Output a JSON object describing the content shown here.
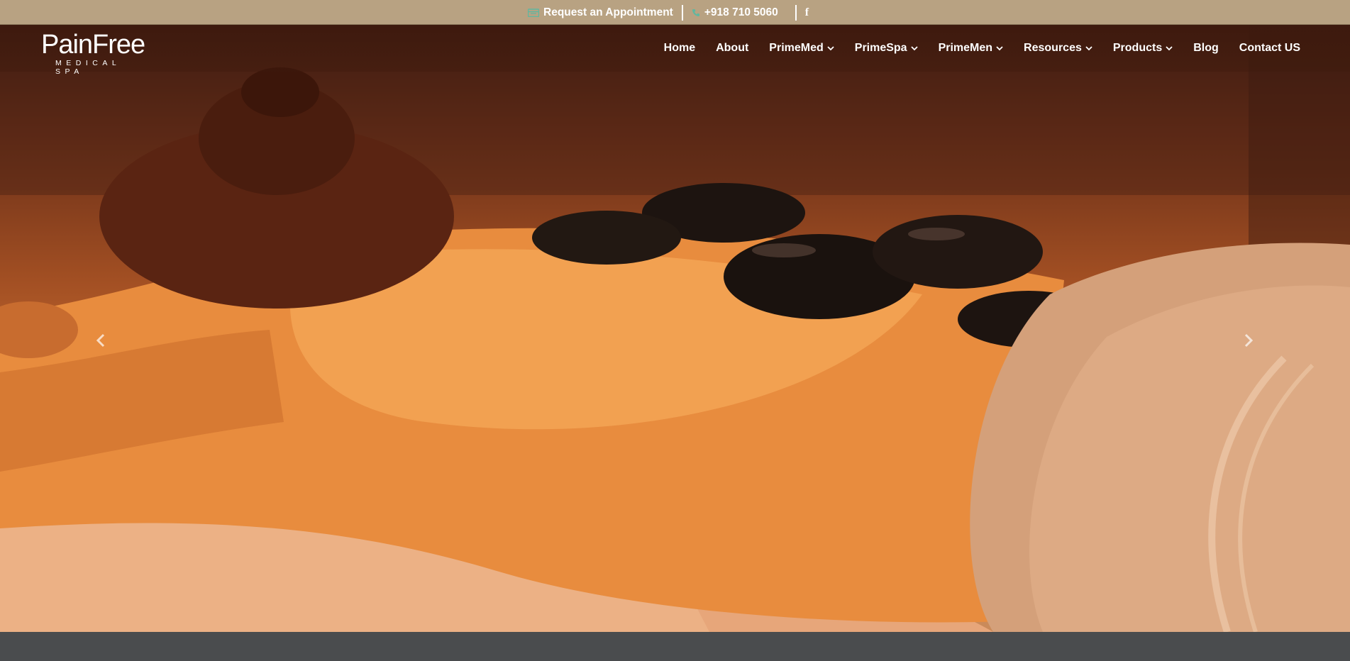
{
  "topbar": {
    "appointment_label": "Request an Appointment",
    "phone": "+918 710 5060",
    "facebook_glyph": "f",
    "icons": {
      "appointment": "calendar-icon",
      "phone": "phone-icon",
      "facebook": "facebook-icon"
    },
    "accent_icon_color": "#5fb7a0"
  },
  "logo": {
    "word": "PainFree",
    "tagline": "MEDICAL  SPA"
  },
  "nav": {
    "items": [
      {
        "label": "Home",
        "dropdown": false
      },
      {
        "label": "About",
        "dropdown": false
      },
      {
        "label": "PrimeMed",
        "dropdown": true
      },
      {
        "label": "PrimeSpa",
        "dropdown": true
      },
      {
        "label": "PrimeMen",
        "dropdown": true
      },
      {
        "label": "Resources",
        "dropdown": true
      },
      {
        "label": "Products",
        "dropdown": true
      },
      {
        "label": "Blog",
        "dropdown": false
      },
      {
        "label": "Contact US",
        "dropdown": false
      }
    ]
  },
  "hero": {
    "image_subject": "hot stone massage",
    "prev_icon": "chevron-left-icon",
    "next_icon": "chevron-right-icon"
  },
  "colors": {
    "topbar_bg": "#b8a282",
    "bottom_bg": "#4a4c4e",
    "text_light": "#ffffff"
  }
}
